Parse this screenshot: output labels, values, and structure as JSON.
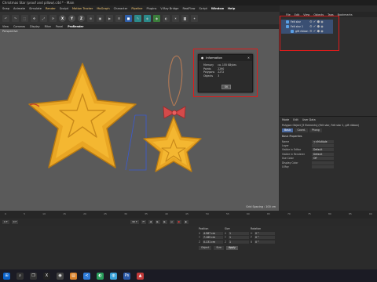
{
  "window_title": "Christmas Star (proof and pillow).c4d * - Main",
  "menu": [
    "Snap",
    "Animate",
    "Simulate",
    "Render",
    "Sculpt",
    "Motion Tracker",
    "MoGraph",
    "Character",
    "Pipeline",
    "Plugins",
    "V-Ray Bridge",
    "RealFlow",
    "Script",
    "Window",
    "Help"
  ],
  "toolbar": {
    "axis_x": "X",
    "axis_y": "Y",
    "axis_z": "Z"
  },
  "viewport_menu": [
    "View",
    "Cameras",
    "Display",
    "Filter",
    "Panel",
    "ProRender"
  ],
  "viewport_label": "Perspective",
  "grid_spacing": "Grid Spacing : 100 cm",
  "info_dialog": {
    "title": "Information",
    "rows": [
      {
        "label": "Memory",
        "value": "ca. 155 KBytes"
      },
      {
        "label": "Points",
        "value": "2290"
      },
      {
        "label": "Polygons",
        "value": "2272"
      },
      {
        "label": "Objects",
        "value": "3"
      }
    ],
    "ok": "OK"
  },
  "object_manager": {
    "menu": [
      "File",
      "Edit",
      "View",
      "Objects",
      "Tags",
      "Bookmarks"
    ],
    "objects": [
      {
        "name": "Felt star",
        "level": 0
      },
      {
        "name": "Felt star 1",
        "level": 0
      },
      {
        "name": "gift ribbon",
        "level": 1
      }
    ]
  },
  "attribute_manager": {
    "menu": [
      "Mode",
      "Edit",
      "User Data"
    ],
    "title": "Polygon Object [3 Elements] (Felt star, Felt star 1, gift ribbon)",
    "tabs": [
      "Basic",
      "Coord.",
      "Phong"
    ],
    "section": "Basic Properties",
    "rows": [
      {
        "label": "Name",
        "value": "<<Multiple Values>>"
      },
      {
        "label": "Layer",
        "value": ""
      },
      {
        "label": "Visible in Editor",
        "value": "Default"
      },
      {
        "label": "Visible in Renderer",
        "value": "Default"
      },
      {
        "label": "Use Color",
        "value": "Off"
      },
      {
        "label": "Display Color",
        "value": ""
      },
      {
        "label": "X-Ray",
        "value": ""
      }
    ]
  },
  "timeline": {
    "ticks": [
      "0",
      "5",
      "10",
      "15",
      "20",
      "25",
      "30",
      "35",
      "40",
      "45",
      "50",
      "55",
      "60",
      "65",
      "70",
      "75",
      "80",
      "85",
      "90"
    ],
    "current_frame": "0 F",
    "start_frame": "0 F",
    "end_frame": "90 F"
  },
  "coordinates": {
    "headers": [
      "Position",
      "Size",
      "Rotation"
    ],
    "rows": [
      {
        "axis": "X",
        "position": "4.587 cm",
        "size": "1",
        "rot_axis": "H",
        "rotation": "0 °"
      },
      {
        "axis": "Y",
        "position": "7.165 cm",
        "size": "1",
        "rot_axis": "P",
        "rotation": "0 °"
      },
      {
        "axis": "Z",
        "position": "0.131 cm",
        "size": "1",
        "rot_axis": "B",
        "rotation": "0 °"
      }
    ],
    "mode": "Object",
    "size_mode": "Size",
    "apply": "Apply"
  },
  "colors": {
    "accent": "#e01b1b",
    "felt": "#f4b731",
    "viewport": "#5a5a5a"
  }
}
